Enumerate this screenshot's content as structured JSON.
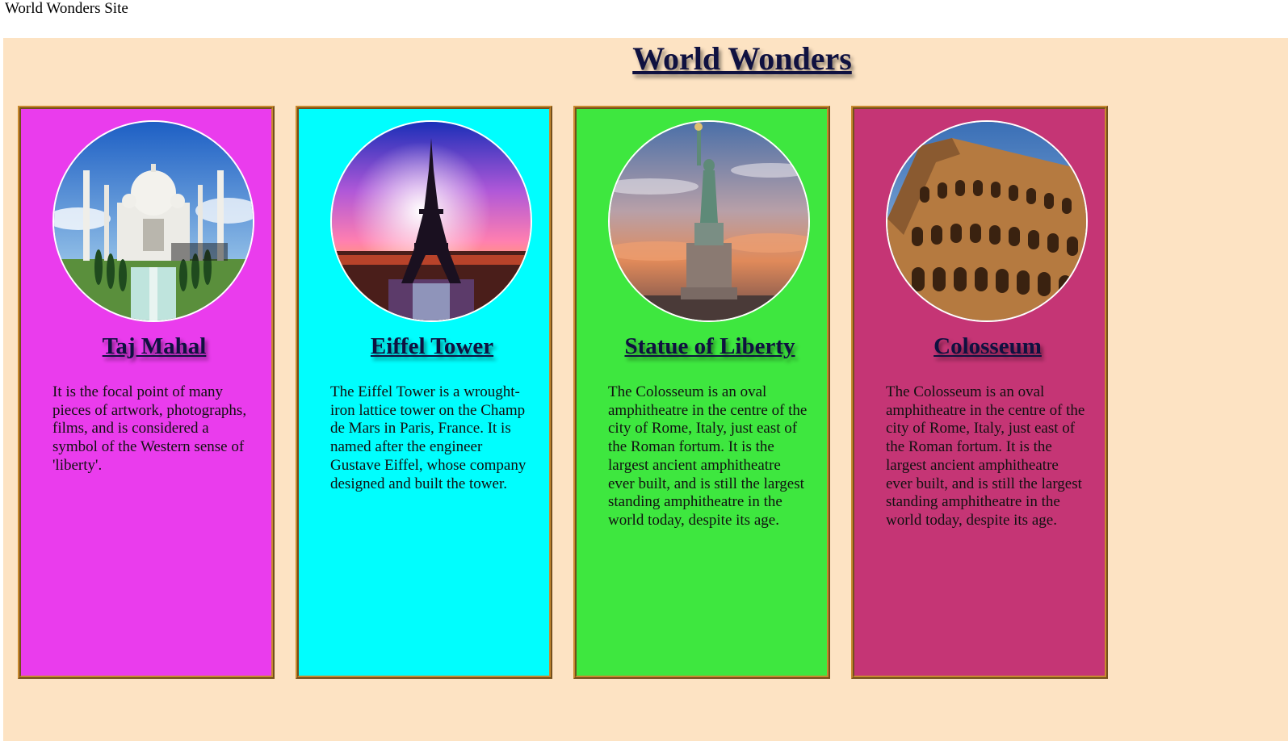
{
  "header": {
    "site_title": "World Wonders Site"
  },
  "main": {
    "title": "World Wonders"
  },
  "cards": [
    {
      "name": "Taj Mahal",
      "description": "It is the focal point of many pieces of artwork, photographs, films, and is considered a symbol of the Western sense of 'liberty'.",
      "color": "#ea3ced",
      "icon": "taj-mahal-image"
    },
    {
      "name": "Eiffel Tower",
      "description": "The Eiffel Tower is a wrought-iron lattice tower on the Champ de Mars in Paris, France. It is named after the engineer Gustave Eiffel, whose company designed and built the tower.",
      "color": "#00fefe",
      "icon": "eiffel-tower-image"
    },
    {
      "name": "Statue of Liberty",
      "description": "The Colosseum is an oval amphitheatre in the centre of the city of Rome, Italy, just east of the Roman fortum. It is the largest ancient amphitheatre ever built, and is still the largest standing amphitheatre in the world today, despite its age.",
      "color": "#3ee73f",
      "icon": "statue-of-liberty-image"
    },
    {
      "name": "Colosseum",
      "description": "The Colosseum is an oval amphitheatre in the centre of the city of Rome, Italy, just east of the Roman fortum. It is the largest ancient amphitheatre ever built, and is still the largest standing amphitheatre in the world today, despite its age.",
      "color": "#c53575",
      "icon": "colosseum-image"
    }
  ]
}
